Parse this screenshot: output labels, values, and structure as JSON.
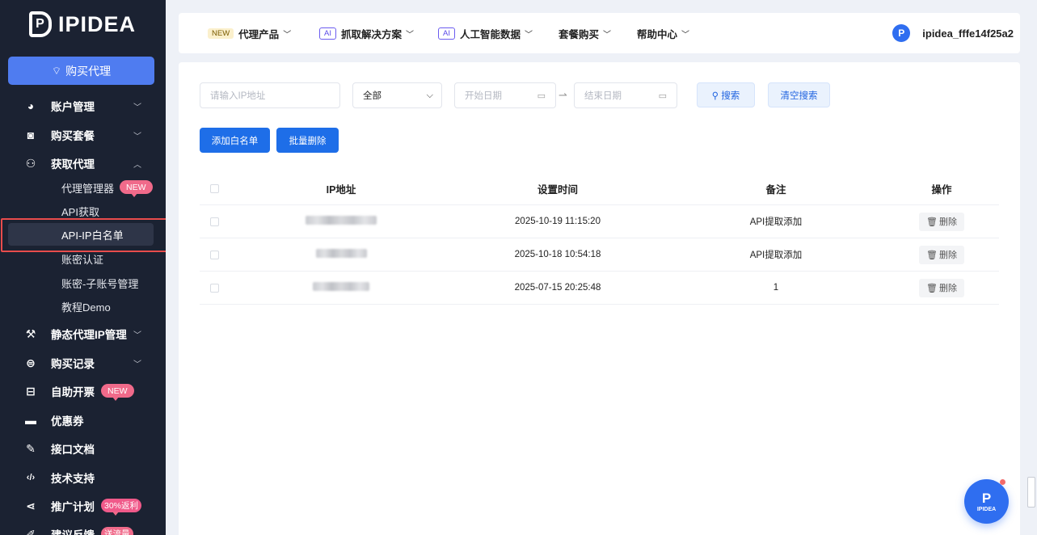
{
  "brand": {
    "name": "IPIDEA",
    "mark": "P"
  },
  "sidebar": {
    "buy_button": "购买代理",
    "items": [
      {
        "label": "账户管理",
        "icon": "pie-chart-icon",
        "glyph": "◕",
        "chevron": "﹀"
      },
      {
        "label": "购买套餐",
        "icon": "shopping-bag-icon",
        "glyph": "◙",
        "chevron": "﹀"
      },
      {
        "label": "获取代理",
        "icon": "user-icon",
        "glyph": "⚇",
        "chevron": "︿"
      },
      {
        "label": "静态代理IP管理",
        "icon": "gun-icon",
        "glyph": "⚒",
        "chevron": "﹀"
      },
      {
        "label": "购买记录",
        "icon": "basket-icon",
        "glyph": "⊜",
        "chevron": "﹀"
      },
      {
        "label": "自助开票",
        "icon": "invoice-icon",
        "glyph": "⊟",
        "badge": "NEW"
      },
      {
        "label": "优惠券",
        "icon": "coupon-icon",
        "glyph": "▬"
      },
      {
        "label": "接口文档",
        "icon": "edit-icon",
        "glyph": "✎"
      },
      {
        "label": "技术支持",
        "icon": "code-icon",
        "glyph": "‹/›"
      },
      {
        "label": "推广计划",
        "icon": "share-icon",
        "glyph": "⋖",
        "badge": "30%返利"
      },
      {
        "label": "建议反馈",
        "icon": "pen-icon",
        "glyph": "✐",
        "badge": "送流量"
      }
    ],
    "subitems": [
      {
        "label": "代理管理器",
        "badge": "NEW"
      },
      {
        "label": "API获取"
      },
      {
        "label": "API-IP白名单"
      },
      {
        "label": "账密认证"
      },
      {
        "label": "账密-子账号管理"
      },
      {
        "label": "教程Demo"
      }
    ]
  },
  "topnav": {
    "items": [
      {
        "pill": "NEW",
        "label": "代理产品"
      },
      {
        "pill": "AI",
        "label": "抓取解决方案"
      },
      {
        "pill": "AI",
        "label": "人工智能数据"
      },
      {
        "label": "套餐购买"
      },
      {
        "label": "帮助中心"
      }
    ],
    "username": "ipidea_fffe14f25a2"
  },
  "filters": {
    "ip_placeholder": "请输入IP地址",
    "type_value": "全部",
    "start_placeholder": "开始日期",
    "end_placeholder": "结束日期",
    "search_label": "搜索",
    "clear_label": "清空搜索"
  },
  "actions": {
    "add_label": "添加白名单",
    "batch_delete_label": "批量删除"
  },
  "table": {
    "headers": {
      "ip": "IP地址",
      "time": "设置时间",
      "note": "备注",
      "op": "操作"
    },
    "rows": [
      {
        "ip": "",
        "time": "2025-10-19 11:15:20",
        "note": "API提取添加",
        "op": "删除"
      },
      {
        "ip": "",
        "time": "2025-10-18 10:54:18",
        "note": "API提取添加",
        "op": "删除"
      },
      {
        "ip": "",
        "time": "2025-07-15 20:25:48",
        "note": "1",
        "op": "删除"
      }
    ]
  },
  "fab": {
    "mark": "P",
    "text": "IPIDEA"
  },
  "colors": {
    "sidebar_bg": "#1b2232",
    "accent": "#1e6ee8",
    "highlight": "#e84c4c",
    "badge": "#f06a8a"
  }
}
